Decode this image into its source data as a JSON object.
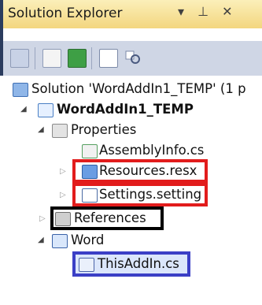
{
  "panel": {
    "title": "Solution Explorer",
    "controls": {
      "dropdown": "▾",
      "pin": "ᅟ",
      "close": "×"
    }
  },
  "toolbar": {
    "tools": [
      "show-all-files",
      "properties",
      "refresh",
      "view-code",
      "view-designer"
    ]
  },
  "tree": {
    "solution": "Solution 'WordAddIn1_TEMP' (1 p",
    "project": "WordAddIn1_TEMP",
    "properties": "Properties",
    "assemblyinfo": "AssemblyInfo.cs",
    "resources": "Resources.resx",
    "settings": "Settings.setting",
    "references": "References",
    "word": "Word",
    "thisaddin": "ThisAddIn.cs"
  },
  "colors": {
    "highlight_red": "#e21c1c",
    "highlight_black": "#000000",
    "highlight_blue": "#3b3fc6",
    "titlebar": "#f3d67f"
  }
}
